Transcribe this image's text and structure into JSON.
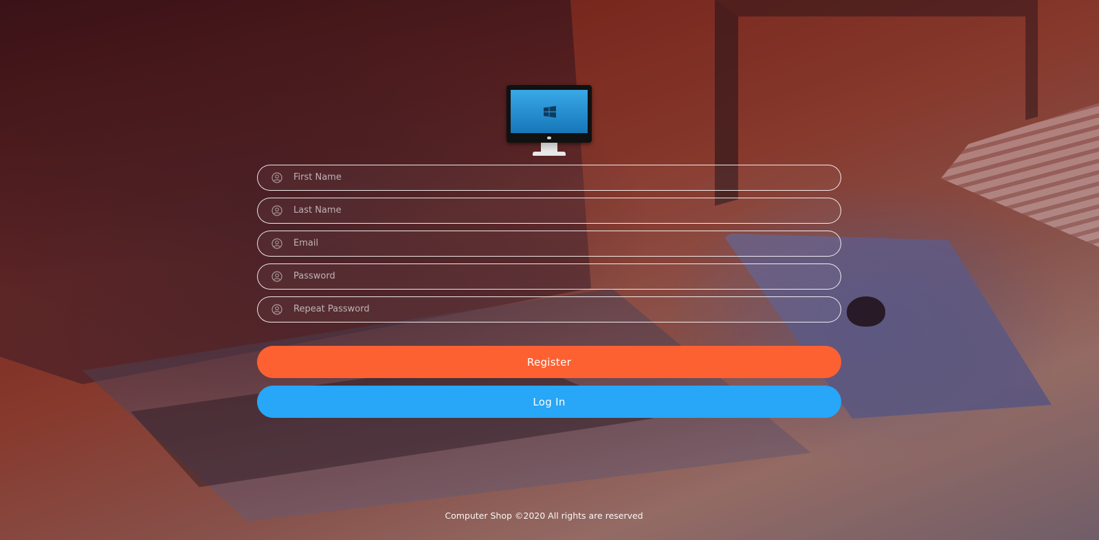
{
  "form": {
    "fields": [
      {
        "name": "first-name",
        "placeholder": "First Name",
        "value": "",
        "icon": "user-circle-icon"
      },
      {
        "name": "last-name",
        "placeholder": "Last Name",
        "value": "",
        "icon": "user-circle-icon"
      },
      {
        "name": "email",
        "placeholder": "Email",
        "value": "",
        "icon": "user-circle-icon"
      },
      {
        "name": "password",
        "placeholder": "Password",
        "value": "",
        "icon": "user-circle-icon"
      },
      {
        "name": "repeat-password",
        "placeholder": "Repeat Password",
        "value": "",
        "icon": "user-circle-icon"
      }
    ],
    "register_label": "Register",
    "login_label": "Log In"
  },
  "logo": {
    "icon": "monitor-windows-icon"
  },
  "footer": {
    "text": "Computer Shop ©2020 All rights are reserved"
  },
  "colors": {
    "register": "#fd6132",
    "login": "#28a6f7",
    "field_border": "#ffffff"
  }
}
